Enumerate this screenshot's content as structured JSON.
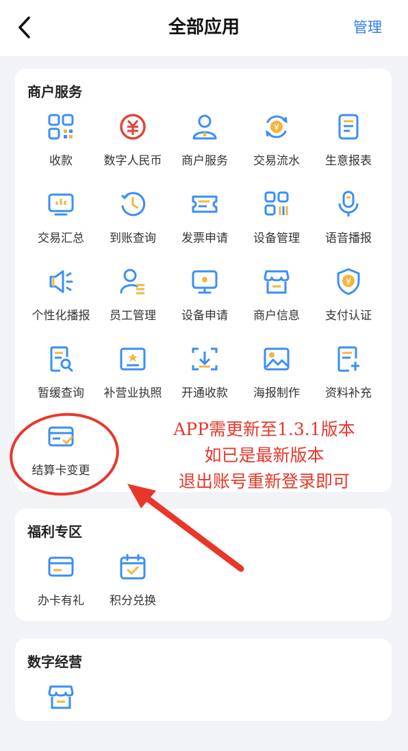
{
  "header": {
    "title": "全部应用",
    "manage_label": "管理"
  },
  "sections": [
    {
      "title": "商户服务",
      "items": [
        {
          "label": "收款",
          "icon": "qr-code-icon"
        },
        {
          "label": "数字人民币",
          "icon": "digital-rmb-icon"
        },
        {
          "label": "商户服务",
          "icon": "user-service-icon"
        },
        {
          "label": "交易流水",
          "icon": "transaction-flow-icon"
        },
        {
          "label": "生意报表",
          "icon": "report-icon"
        },
        {
          "label": "交易汇总",
          "icon": "summary-monitor-icon"
        },
        {
          "label": "到账查询",
          "icon": "clock-history-icon"
        },
        {
          "label": "发票申请",
          "icon": "invoice-ticket-icon"
        },
        {
          "label": "设备管理",
          "icon": "device-grid-icon"
        },
        {
          "label": "语音播报",
          "icon": "microphone-icon"
        },
        {
          "label": "个性化播报",
          "icon": "speaker-icon"
        },
        {
          "label": "员工管理",
          "icon": "staff-icon"
        },
        {
          "label": "设备申请",
          "icon": "monitor-icon"
        },
        {
          "label": "商户信息",
          "icon": "store-icon"
        },
        {
          "label": "支付认证",
          "icon": "shield-yen-icon"
        },
        {
          "label": "暂缓查询",
          "icon": "document-search-icon"
        },
        {
          "label": "补营业执照",
          "icon": "license-icon"
        },
        {
          "label": "开通收款",
          "icon": "download-frame-icon"
        },
        {
          "label": "海报制作",
          "icon": "image-icon"
        },
        {
          "label": "资料补充",
          "icon": "document-add-icon"
        },
        {
          "label": "结算卡变更",
          "icon": "card-check-icon"
        }
      ]
    },
    {
      "title": "福利专区",
      "items": [
        {
          "label": "办卡有礼",
          "icon": "card-icon"
        },
        {
          "label": "积分兑换",
          "icon": "calendar-check-icon"
        }
      ]
    },
    {
      "title": "数字经营",
      "items": [
        {
          "label": "",
          "icon": "store-icon"
        }
      ]
    }
  ],
  "notice": {
    "line1": "APP需更新至1.3.1版本",
    "line2": "如已是最新版本",
    "line3": "退出账号重新登录即可"
  },
  "colors": {
    "accent": "#2d7bf0",
    "icon_blue": "#3a8ef6",
    "icon_yellow": "#f5b53c",
    "icon_red": "#e0443a",
    "annotation_red": "#e8372a"
  }
}
